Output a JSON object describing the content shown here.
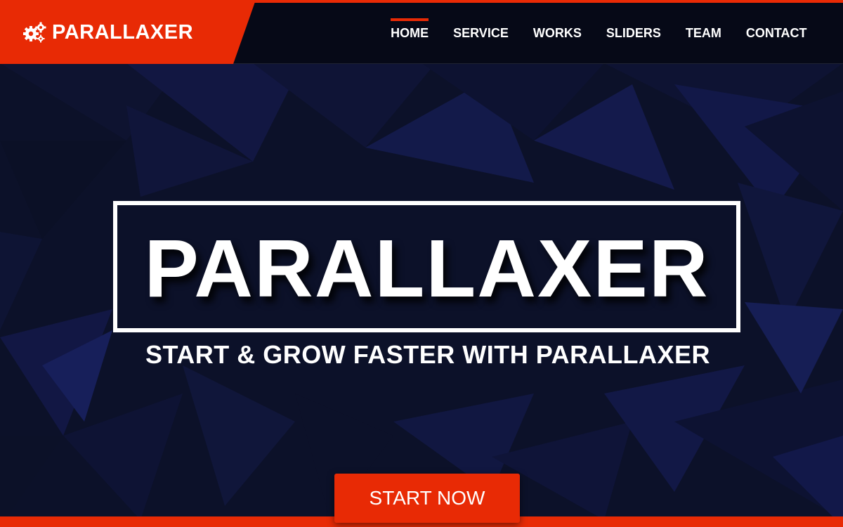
{
  "colors": {
    "accent": "#e82a05",
    "nav_background": "#06081a",
    "hero_background": "#0c1028"
  },
  "brand": {
    "name": "PARALLAXER",
    "icon": "gears-icon"
  },
  "nav": {
    "items": [
      {
        "label": "HOME",
        "active": true
      },
      {
        "label": "SERVICE",
        "active": false
      },
      {
        "label": "WORKS",
        "active": false
      },
      {
        "label": "SLIDERS",
        "active": false
      },
      {
        "label": "TEAM",
        "active": false
      },
      {
        "label": "CONTACT",
        "active": false
      }
    ]
  },
  "hero": {
    "title": "PARALLAXER",
    "subtitle": "START & GROW FASTER WITH PARALLAXER",
    "cta_label": "START NOW"
  }
}
